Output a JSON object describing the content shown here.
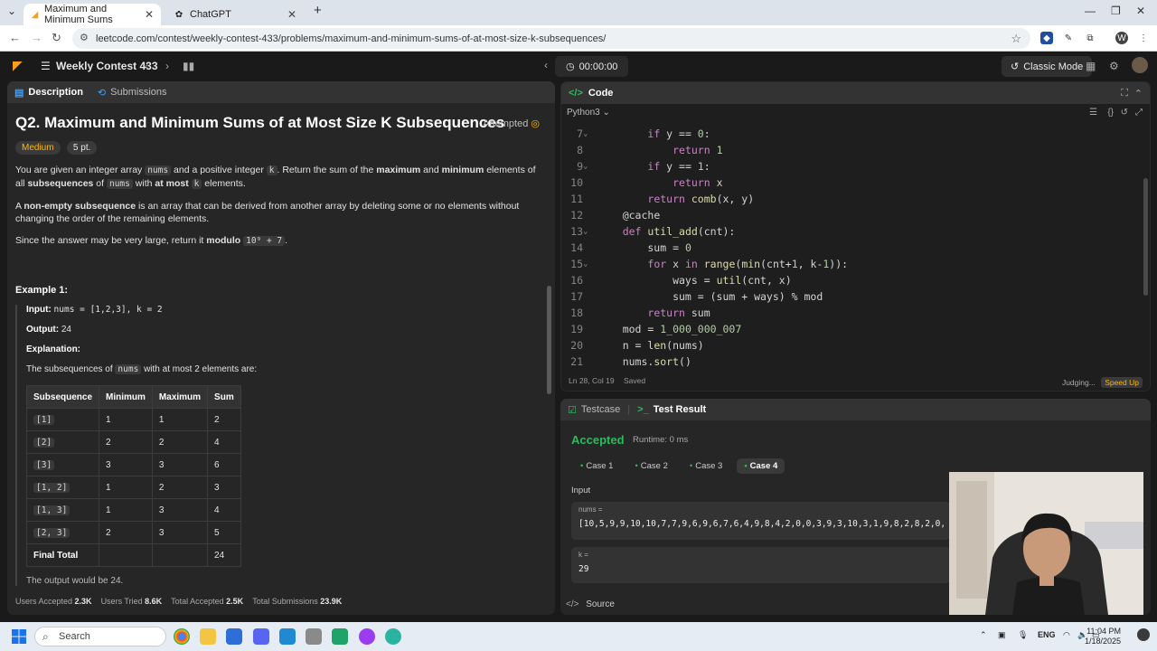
{
  "browser": {
    "tabs": [
      {
        "title": "Maximum and Minimum Sums",
        "active": true
      },
      {
        "title": "ChatGPT",
        "active": false
      }
    ],
    "url": "leetcode.com/contest/weekly-contest-433/problems/maximum-and-minimum-sums-of-at-most-size-k-subsequences/",
    "profile_initial": "W"
  },
  "nav": {
    "contest": "Weekly Contest 433",
    "timer": "00:00:00",
    "classic_mode": "Classic Mode"
  },
  "left": {
    "tab_description": "Description",
    "tab_submissions": "Submissions",
    "title": "Q2. Maximum and Minimum Sums of at Most Size K Subsequences",
    "attempted": "Attempted",
    "difficulty": "Medium",
    "points": "5 pt.",
    "p1": {
      "a": "You are given an integer array ",
      "nums": "nums",
      "b": " and a positive integer ",
      "k": "k",
      "c": ". Return the sum of the ",
      "max": "maximum",
      "d": " and ",
      "min": "minimum",
      "e": " elements of all ",
      "subseq": "subsequences",
      "f": " of ",
      "g": " with ",
      "atmost": "at most",
      "h": " elements."
    },
    "p2": {
      "a": "A ",
      "nes": "non-empty subsequence",
      "b": " is an array that can be derived from another array by deleting some or no elements without changing the order of the remaining elements."
    },
    "p3": {
      "a": "Since the answer may be very large, return it ",
      "modulo": "modulo",
      "mod_code": "10⁹ + 7",
      "b": "."
    },
    "example_title": "Example 1:",
    "example": {
      "input_label": "Input:",
      "input": "nums = [1,2,3], k = 2",
      "output_label": "Output:",
      "output": "24",
      "explanation_label": "Explanation:",
      "expl_a": "The subsequences of ",
      "expl_code": "nums",
      "expl_b": " with at most 2 elements are:"
    },
    "table": {
      "headers": [
        "Subsequence",
        "Minimum",
        "Maximum",
        "Sum"
      ],
      "rows": [
        [
          "[1]",
          "1",
          "1",
          "2"
        ],
        [
          "[2]",
          "2",
          "2",
          "4"
        ],
        [
          "[3]",
          "3",
          "3",
          "6"
        ],
        [
          "[1, 2]",
          "1",
          "2",
          "3"
        ],
        [
          "[1, 3]",
          "1",
          "3",
          "4"
        ],
        [
          "[2, 3]",
          "2",
          "3",
          "5"
        ],
        [
          "Final Total",
          "",
          "",
          "24"
        ]
      ]
    },
    "trailing": "The output would be 24.",
    "stats": {
      "users_accepted_label": "Users Accepted",
      "users_accepted": "2.3K",
      "users_tried_label": "Users Tried",
      "users_tried": "8.6K",
      "total_accepted_label": "Total Accepted",
      "total_accepted": "2.5K",
      "total_submissions_label": "Total Submissions",
      "total_submissions": "23.9K"
    }
  },
  "code": {
    "header": "Code",
    "language": "Python3",
    "lines": [
      {
        "n": "7",
        "fold": true,
        "text": "        if y == 0:"
      },
      {
        "n": "8",
        "fold": false,
        "text": "            return 1"
      },
      {
        "n": "9",
        "fold": true,
        "text": "        if y == 1:"
      },
      {
        "n": "10",
        "fold": false,
        "text": "            return x"
      },
      {
        "n": "11",
        "fold": false,
        "text": "        return comb(x, y)"
      },
      {
        "n": "12",
        "fold": false,
        "text": "    @cache"
      },
      {
        "n": "13",
        "fold": true,
        "text": "    def util_add(cnt):"
      },
      {
        "n": "14",
        "fold": false,
        "text": "        sum = 0"
      },
      {
        "n": "15",
        "fold": true,
        "text": "        for x in range(min(cnt+1, k-1)):"
      },
      {
        "n": "16",
        "fold": false,
        "text": "            ways = util(cnt, x)"
      },
      {
        "n": "17",
        "fold": false,
        "text": "            sum = (sum + ways) % mod"
      },
      {
        "n": "18",
        "fold": false,
        "text": "        return sum"
      },
      {
        "n": "19",
        "fold": false,
        "text": "    mod = 1_000_000_007"
      },
      {
        "n": "20",
        "fold": false,
        "text": "    n = len(nums)"
      },
      {
        "n": "21",
        "fold": false,
        "text": "    nums.sort()"
      }
    ],
    "cursor": "Ln 28, Col 19",
    "saved": "Saved",
    "judging": "Judging...",
    "speed_up": "Speed Up"
  },
  "result": {
    "tab_testcase": "Testcase",
    "tab_result": "Test Result",
    "status": "Accepted",
    "runtime": "Runtime: 0 ms",
    "cases": [
      "Case 1",
      "Case 2",
      "Case 3",
      "Case 4"
    ],
    "input_label": "Input",
    "nums_label": "nums =",
    "nums_value": "[10,5,9,9,10,10,7,7,9,6,9,6,7,6,4,9,8,4,2,0,0,3,9,3,10,3,1,9,8,2,8,2,0,7,",
    "k_label": "k =",
    "k_value": "29",
    "source": "Source"
  },
  "taskbar": {
    "search": "Search",
    "lang": "ENG",
    "time": "11:04 PM",
    "date": "1/18/2025"
  }
}
